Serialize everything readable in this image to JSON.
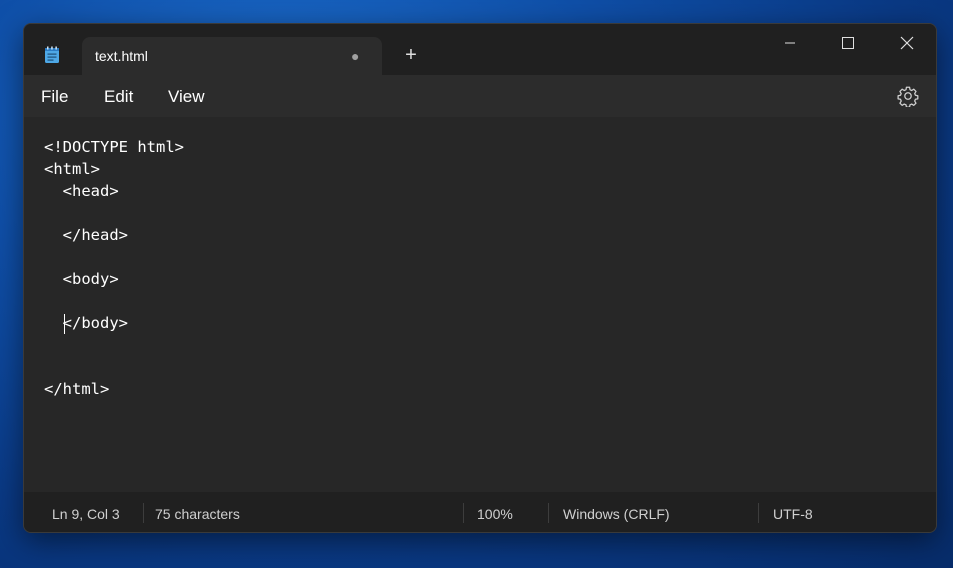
{
  "tab": {
    "title": "text.html",
    "unsaved_dot": "●",
    "new_tab": "+"
  },
  "menu": {
    "file": "File",
    "edit": "Edit",
    "view": "View"
  },
  "code": [
    "<!DOCTYPE html>",
    "<html>",
    "  <head>",
    "",
    "  </head>",
    "",
    "  <body>",
    "",
    "  </body>",
    "",
    "",
    "</html>"
  ],
  "status": {
    "position": "Ln 9, Col 3",
    "characters": "75 characters",
    "zoom": "100%",
    "line_ending": "Windows (CRLF)",
    "encoding": "UTF-8"
  },
  "icons": {
    "app": "notepad-icon",
    "minimize": "minimize-icon",
    "maximize": "maximize-icon",
    "close": "close-icon",
    "settings": "gear-icon"
  }
}
